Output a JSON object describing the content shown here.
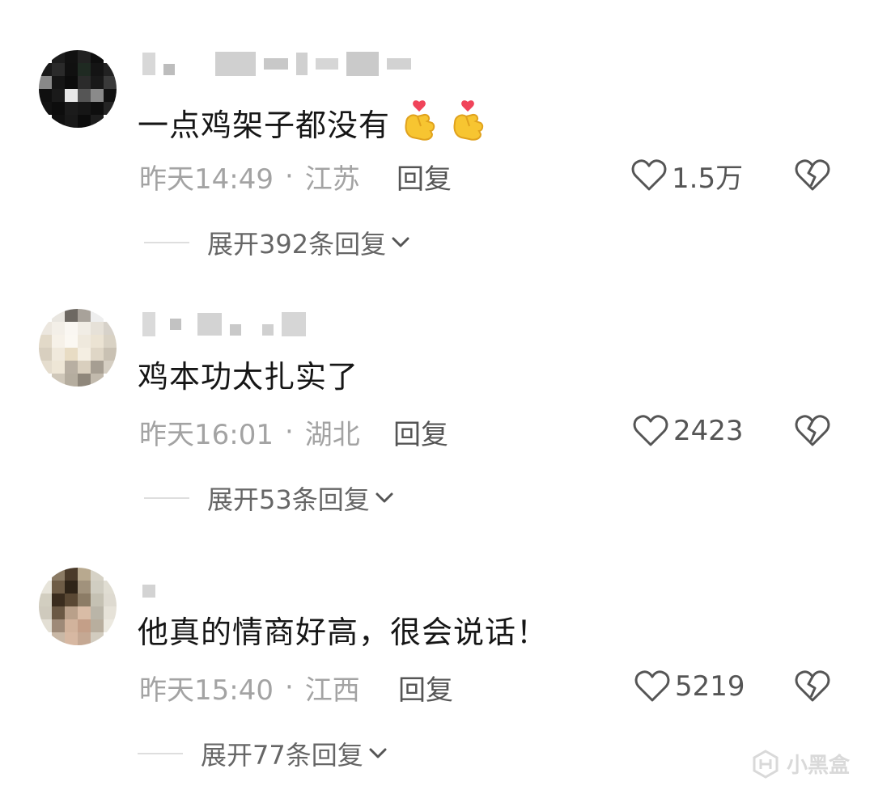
{
  "comments": [
    {
      "text": "一点鸡架子都没有",
      "emoji": [
        "finger-heart",
        "finger-heart"
      ],
      "time": "昨天14:49",
      "separator": "·",
      "location": "江苏",
      "reply": "回复",
      "likes": "1.5万",
      "expand": "展开392条回复"
    },
    {
      "text": "鸡本功太扎实了",
      "emoji": [],
      "time": "昨天16:01",
      "separator": "·",
      "location": "湖北",
      "reply": "回复",
      "likes": "2423",
      "expand": "展开53条回复"
    },
    {
      "text": "他真的情商好高，很会说话！",
      "emoji": [],
      "time": "昨天15:40",
      "separator": "·",
      "location": "江西",
      "reply": "回复",
      "likes": "5219",
      "expand": "展开77条回复"
    }
  ],
  "watermark": "小黑盒",
  "colors": {
    "text": "#161616",
    "meta": "#a3a3a3",
    "action": "#555555",
    "divider": "#dedede",
    "blur": "#d4d4d4"
  }
}
